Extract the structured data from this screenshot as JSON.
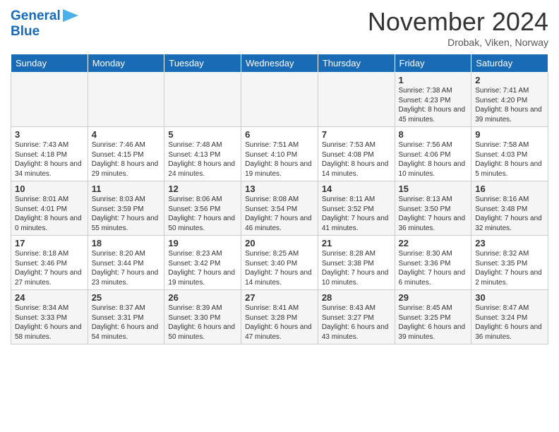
{
  "header": {
    "logo_line1": "General",
    "logo_line2": "Blue",
    "month": "November 2024",
    "location": "Drobak, Viken, Norway"
  },
  "days_of_week": [
    "Sunday",
    "Monday",
    "Tuesday",
    "Wednesday",
    "Thursday",
    "Friday",
    "Saturday"
  ],
  "weeks": [
    [
      {
        "day": "",
        "info": ""
      },
      {
        "day": "",
        "info": ""
      },
      {
        "day": "",
        "info": ""
      },
      {
        "day": "",
        "info": ""
      },
      {
        "day": "",
        "info": ""
      },
      {
        "day": "1",
        "info": "Sunrise: 7:38 AM\nSunset: 4:23 PM\nDaylight: 8 hours and 45 minutes."
      },
      {
        "day": "2",
        "info": "Sunrise: 7:41 AM\nSunset: 4:20 PM\nDaylight: 8 hours and 39 minutes."
      }
    ],
    [
      {
        "day": "3",
        "info": "Sunrise: 7:43 AM\nSunset: 4:18 PM\nDaylight: 8 hours and 34 minutes."
      },
      {
        "day": "4",
        "info": "Sunrise: 7:46 AM\nSunset: 4:15 PM\nDaylight: 8 hours and 29 minutes."
      },
      {
        "day": "5",
        "info": "Sunrise: 7:48 AM\nSunset: 4:13 PM\nDaylight: 8 hours and 24 minutes."
      },
      {
        "day": "6",
        "info": "Sunrise: 7:51 AM\nSunset: 4:10 PM\nDaylight: 8 hours and 19 minutes."
      },
      {
        "day": "7",
        "info": "Sunrise: 7:53 AM\nSunset: 4:08 PM\nDaylight: 8 hours and 14 minutes."
      },
      {
        "day": "8",
        "info": "Sunrise: 7:56 AM\nSunset: 4:06 PM\nDaylight: 8 hours and 10 minutes."
      },
      {
        "day": "9",
        "info": "Sunrise: 7:58 AM\nSunset: 4:03 PM\nDaylight: 8 hours and 5 minutes."
      }
    ],
    [
      {
        "day": "10",
        "info": "Sunrise: 8:01 AM\nSunset: 4:01 PM\nDaylight: 8 hours and 0 minutes."
      },
      {
        "day": "11",
        "info": "Sunrise: 8:03 AM\nSunset: 3:59 PM\nDaylight: 7 hours and 55 minutes."
      },
      {
        "day": "12",
        "info": "Sunrise: 8:06 AM\nSunset: 3:56 PM\nDaylight: 7 hours and 50 minutes."
      },
      {
        "day": "13",
        "info": "Sunrise: 8:08 AM\nSunset: 3:54 PM\nDaylight: 7 hours and 46 minutes."
      },
      {
        "day": "14",
        "info": "Sunrise: 8:11 AM\nSunset: 3:52 PM\nDaylight: 7 hours and 41 minutes."
      },
      {
        "day": "15",
        "info": "Sunrise: 8:13 AM\nSunset: 3:50 PM\nDaylight: 7 hours and 36 minutes."
      },
      {
        "day": "16",
        "info": "Sunrise: 8:16 AM\nSunset: 3:48 PM\nDaylight: 7 hours and 32 minutes."
      }
    ],
    [
      {
        "day": "17",
        "info": "Sunrise: 8:18 AM\nSunset: 3:46 PM\nDaylight: 7 hours and 27 minutes."
      },
      {
        "day": "18",
        "info": "Sunrise: 8:20 AM\nSunset: 3:44 PM\nDaylight: 7 hours and 23 minutes."
      },
      {
        "day": "19",
        "info": "Sunrise: 8:23 AM\nSunset: 3:42 PM\nDaylight: 7 hours and 19 minutes."
      },
      {
        "day": "20",
        "info": "Sunrise: 8:25 AM\nSunset: 3:40 PM\nDaylight: 7 hours and 14 minutes."
      },
      {
        "day": "21",
        "info": "Sunrise: 8:28 AM\nSunset: 3:38 PM\nDaylight: 7 hours and 10 minutes."
      },
      {
        "day": "22",
        "info": "Sunrise: 8:30 AM\nSunset: 3:36 PM\nDaylight: 7 hours and 6 minutes."
      },
      {
        "day": "23",
        "info": "Sunrise: 8:32 AM\nSunset: 3:35 PM\nDaylight: 7 hours and 2 minutes."
      }
    ],
    [
      {
        "day": "24",
        "info": "Sunrise: 8:34 AM\nSunset: 3:33 PM\nDaylight: 6 hours and 58 minutes."
      },
      {
        "day": "25",
        "info": "Sunrise: 8:37 AM\nSunset: 3:31 PM\nDaylight: 6 hours and 54 minutes."
      },
      {
        "day": "26",
        "info": "Sunrise: 8:39 AM\nSunset: 3:30 PM\nDaylight: 6 hours and 50 minutes."
      },
      {
        "day": "27",
        "info": "Sunrise: 8:41 AM\nSunset: 3:28 PM\nDaylight: 6 hours and 47 minutes."
      },
      {
        "day": "28",
        "info": "Sunrise: 8:43 AM\nSunset: 3:27 PM\nDaylight: 6 hours and 43 minutes."
      },
      {
        "day": "29",
        "info": "Sunrise: 8:45 AM\nSunset: 3:25 PM\nDaylight: 6 hours and 39 minutes."
      },
      {
        "day": "30",
        "info": "Sunrise: 8:47 AM\nSunset: 3:24 PM\nDaylight: 6 hours and 36 minutes."
      }
    ]
  ]
}
